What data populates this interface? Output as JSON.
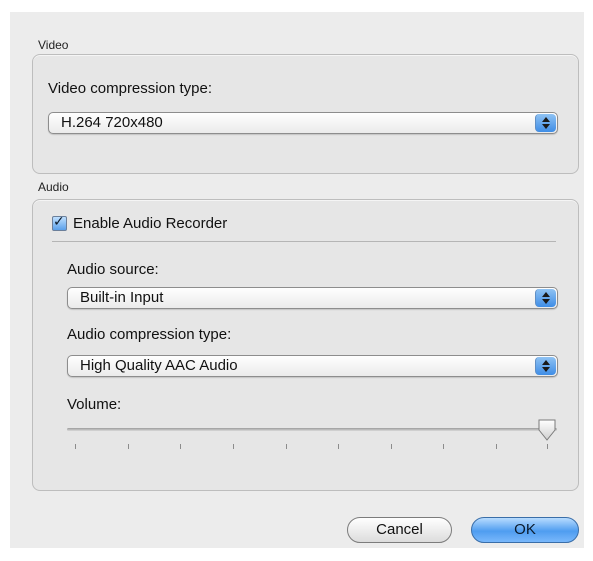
{
  "video": {
    "group_title": "Video",
    "compression_label": "Video compression type:",
    "compression_value": "H.264 720x480"
  },
  "audio": {
    "group_title": "Audio",
    "enable_label": "Enable Audio Recorder",
    "enable_checked": true,
    "source_label": "Audio source:",
    "source_value": "Built-in Input",
    "compression_label": "Audio compression type:",
    "compression_value": "High Quality AAC Audio",
    "volume_label": "Volume:",
    "volume_level": 1.0
  },
  "buttons": {
    "cancel_label": "Cancel",
    "ok_label": "OK"
  },
  "icons": {
    "popup_arrows": "up-down-arrows-icon",
    "checkmark": "checkmark-icon",
    "slider_knob": "slider-knob-icon"
  }
}
